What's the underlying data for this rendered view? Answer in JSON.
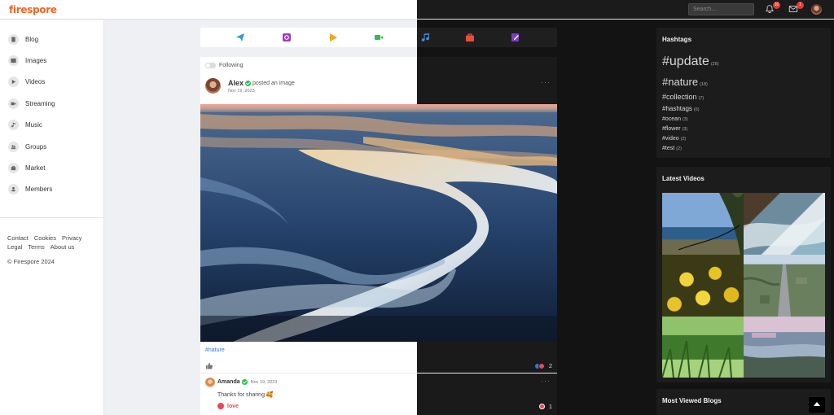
{
  "header": {
    "logo": "firespore",
    "search_placeholder": "Search...",
    "notifications_count": "10",
    "messages_count": "1"
  },
  "sidebar": {
    "items": [
      {
        "label": "Blog",
        "icon": "document-icon"
      },
      {
        "label": "Images",
        "icon": "image-icon"
      },
      {
        "label": "Videos",
        "icon": "play-icon"
      },
      {
        "label": "Streaming",
        "icon": "camera-icon"
      },
      {
        "label": "Music",
        "icon": "music-icon"
      },
      {
        "label": "Groups",
        "icon": "users-icon"
      },
      {
        "label": "Market",
        "icon": "bag-icon"
      },
      {
        "label": "Members",
        "icon": "user-icon"
      }
    ],
    "footer_links_row1": [
      "Contact",
      "Cookies",
      "Privacy"
    ],
    "footer_links_row2": [
      "Legal",
      "Terms",
      "About us"
    ],
    "copyright": "© Firespore 2024"
  },
  "actionbar": {
    "icons": [
      "send-icon",
      "camera-icon",
      "play-icon",
      "video-icon",
      "music-icon",
      "bag-icon",
      "edit-icon"
    ],
    "colors": [
      "#2f9bd6",
      "#9b3fc2",
      "#f5a623",
      "#2dbe4e",
      "#4a90d9",
      "#e74c3c",
      "#7b3fc2"
    ]
  },
  "post": {
    "follow_label": "Following",
    "author": "Alex",
    "action": "posted an image",
    "date": "Nov 19, 2023",
    "hashtag": "#nature",
    "reaction_count": "2",
    "comment": {
      "author": "Amanda",
      "date": "Nov 19, 2023",
      "text": "Thanks for sharing 🥰",
      "reaction_label": "love",
      "reaction_count": "1"
    }
  },
  "hashtags_panel": {
    "title": "Hashtags",
    "tags": [
      {
        "tag": "#update",
        "count": "(26)"
      },
      {
        "tag": "#nature",
        "count": "(18)"
      },
      {
        "tag": "#collection",
        "count": "(7)"
      },
      {
        "tag": "#hashtags",
        "count": "(6)"
      },
      {
        "tag": "#ocean",
        "count": "(3)"
      },
      {
        "tag": "#flower",
        "count": "(3)"
      },
      {
        "tag": "#video",
        "count": "(2)"
      },
      {
        "tag": "#test",
        "count": "(2)"
      }
    ]
  },
  "videos_panel": {
    "title": "Latest Videos"
  },
  "blogs_panel": {
    "title": "Most Viewed Blogs"
  },
  "colors": {
    "brand": "#f26522",
    "link": "#2f7bd8",
    "verified": "#2dbe4e",
    "love": "#e8475a"
  }
}
